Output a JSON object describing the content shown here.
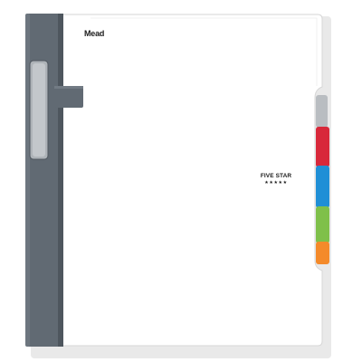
{
  "notebook": {
    "brand_logo": "Mead",
    "product_logo": "FIVE STAR",
    "stars": "★★★★★",
    "colors": {
      "cover": "#ffffff",
      "spine": "#616a73",
      "spine_dark": "#4e565e",
      "tab_gray": "#b9bdc1",
      "tab_red": "#d8283a",
      "tab_blue": "#1f8fd6",
      "tab_green": "#7fc04a",
      "tab_orange": "#f48a2a"
    },
    "icons": [
      "notebook-cover",
      "subject-divider-tabs",
      "pocket-pull-tab"
    ]
  }
}
